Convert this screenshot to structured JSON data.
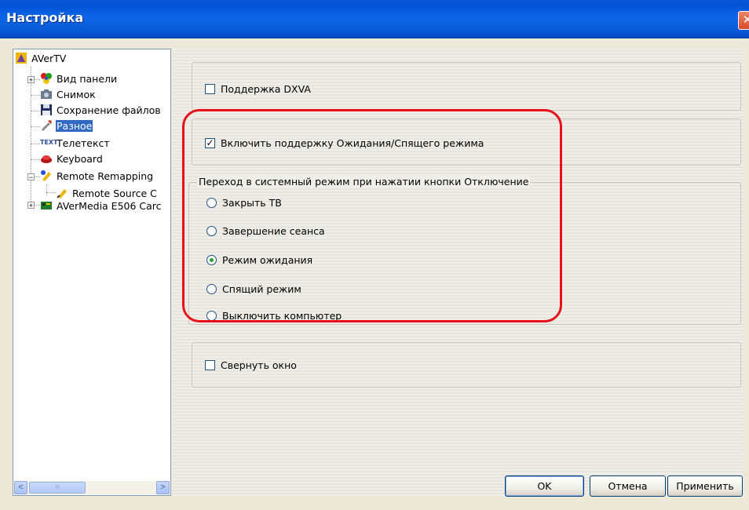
{
  "window": {
    "title": "Настройка",
    "close_glyph": "✕"
  },
  "tree": {
    "items": [
      {
        "label": "AVerTV",
        "icon": "avertv-icon"
      },
      {
        "label": "Вид панели",
        "icon": "panel-view-icon"
      },
      {
        "label": "Снимок",
        "icon": "camera-icon"
      },
      {
        "label": "Сохранение файлов",
        "icon": "floppy-disk-icon"
      },
      {
        "label": "Разное",
        "icon": "misc-tools-icon"
      },
      {
        "label": "Телетекст",
        "icon": "teletext-icon"
      },
      {
        "label": "Keyboard",
        "icon": "keyboard-icon"
      },
      {
        "label": "Remote Remapping",
        "icon": "remote-remap-icon"
      },
      {
        "label": "Remote Source C",
        "icon": "remote-source-icon"
      },
      {
        "label": "AVerMedia E506 Carc",
        "icon": "tv-card-icon"
      }
    ],
    "expander_plus": "+",
    "expander_minus": "−",
    "teletext_icon_text": "TEXT",
    "scroll_left": "<",
    "scroll_right": ">",
    "scroll_thumb": "III"
  },
  "options": {
    "dxva_label": "Поддержка DXVA",
    "dxva_checked": false,
    "standby_label": "Включить поддержку Ожидания/Спящего режима",
    "standby_checked": true,
    "standby_check_glyph": "✓",
    "power_group_legend": "Переход в системный режим при нажатии кнопки Отключение",
    "power_options": [
      {
        "label": "Закрыть ТВ",
        "selected": false
      },
      {
        "label": "Завершение сеанса",
        "selected": false
      },
      {
        "label": "Режим ожидания",
        "selected": true
      },
      {
        "label": "Спящий режим",
        "selected": false
      },
      {
        "label": "Выключить компьютер",
        "selected": false
      }
    ],
    "minimize_label": "Свернуть окно",
    "minimize_checked": false
  },
  "buttons": {
    "ok": "OK",
    "cancel": "Отмена",
    "apply": "Применить"
  },
  "colors": {
    "highlight": "#e8101a",
    "selection": "#316ac5",
    "titlebar": "#0a5ad6"
  }
}
